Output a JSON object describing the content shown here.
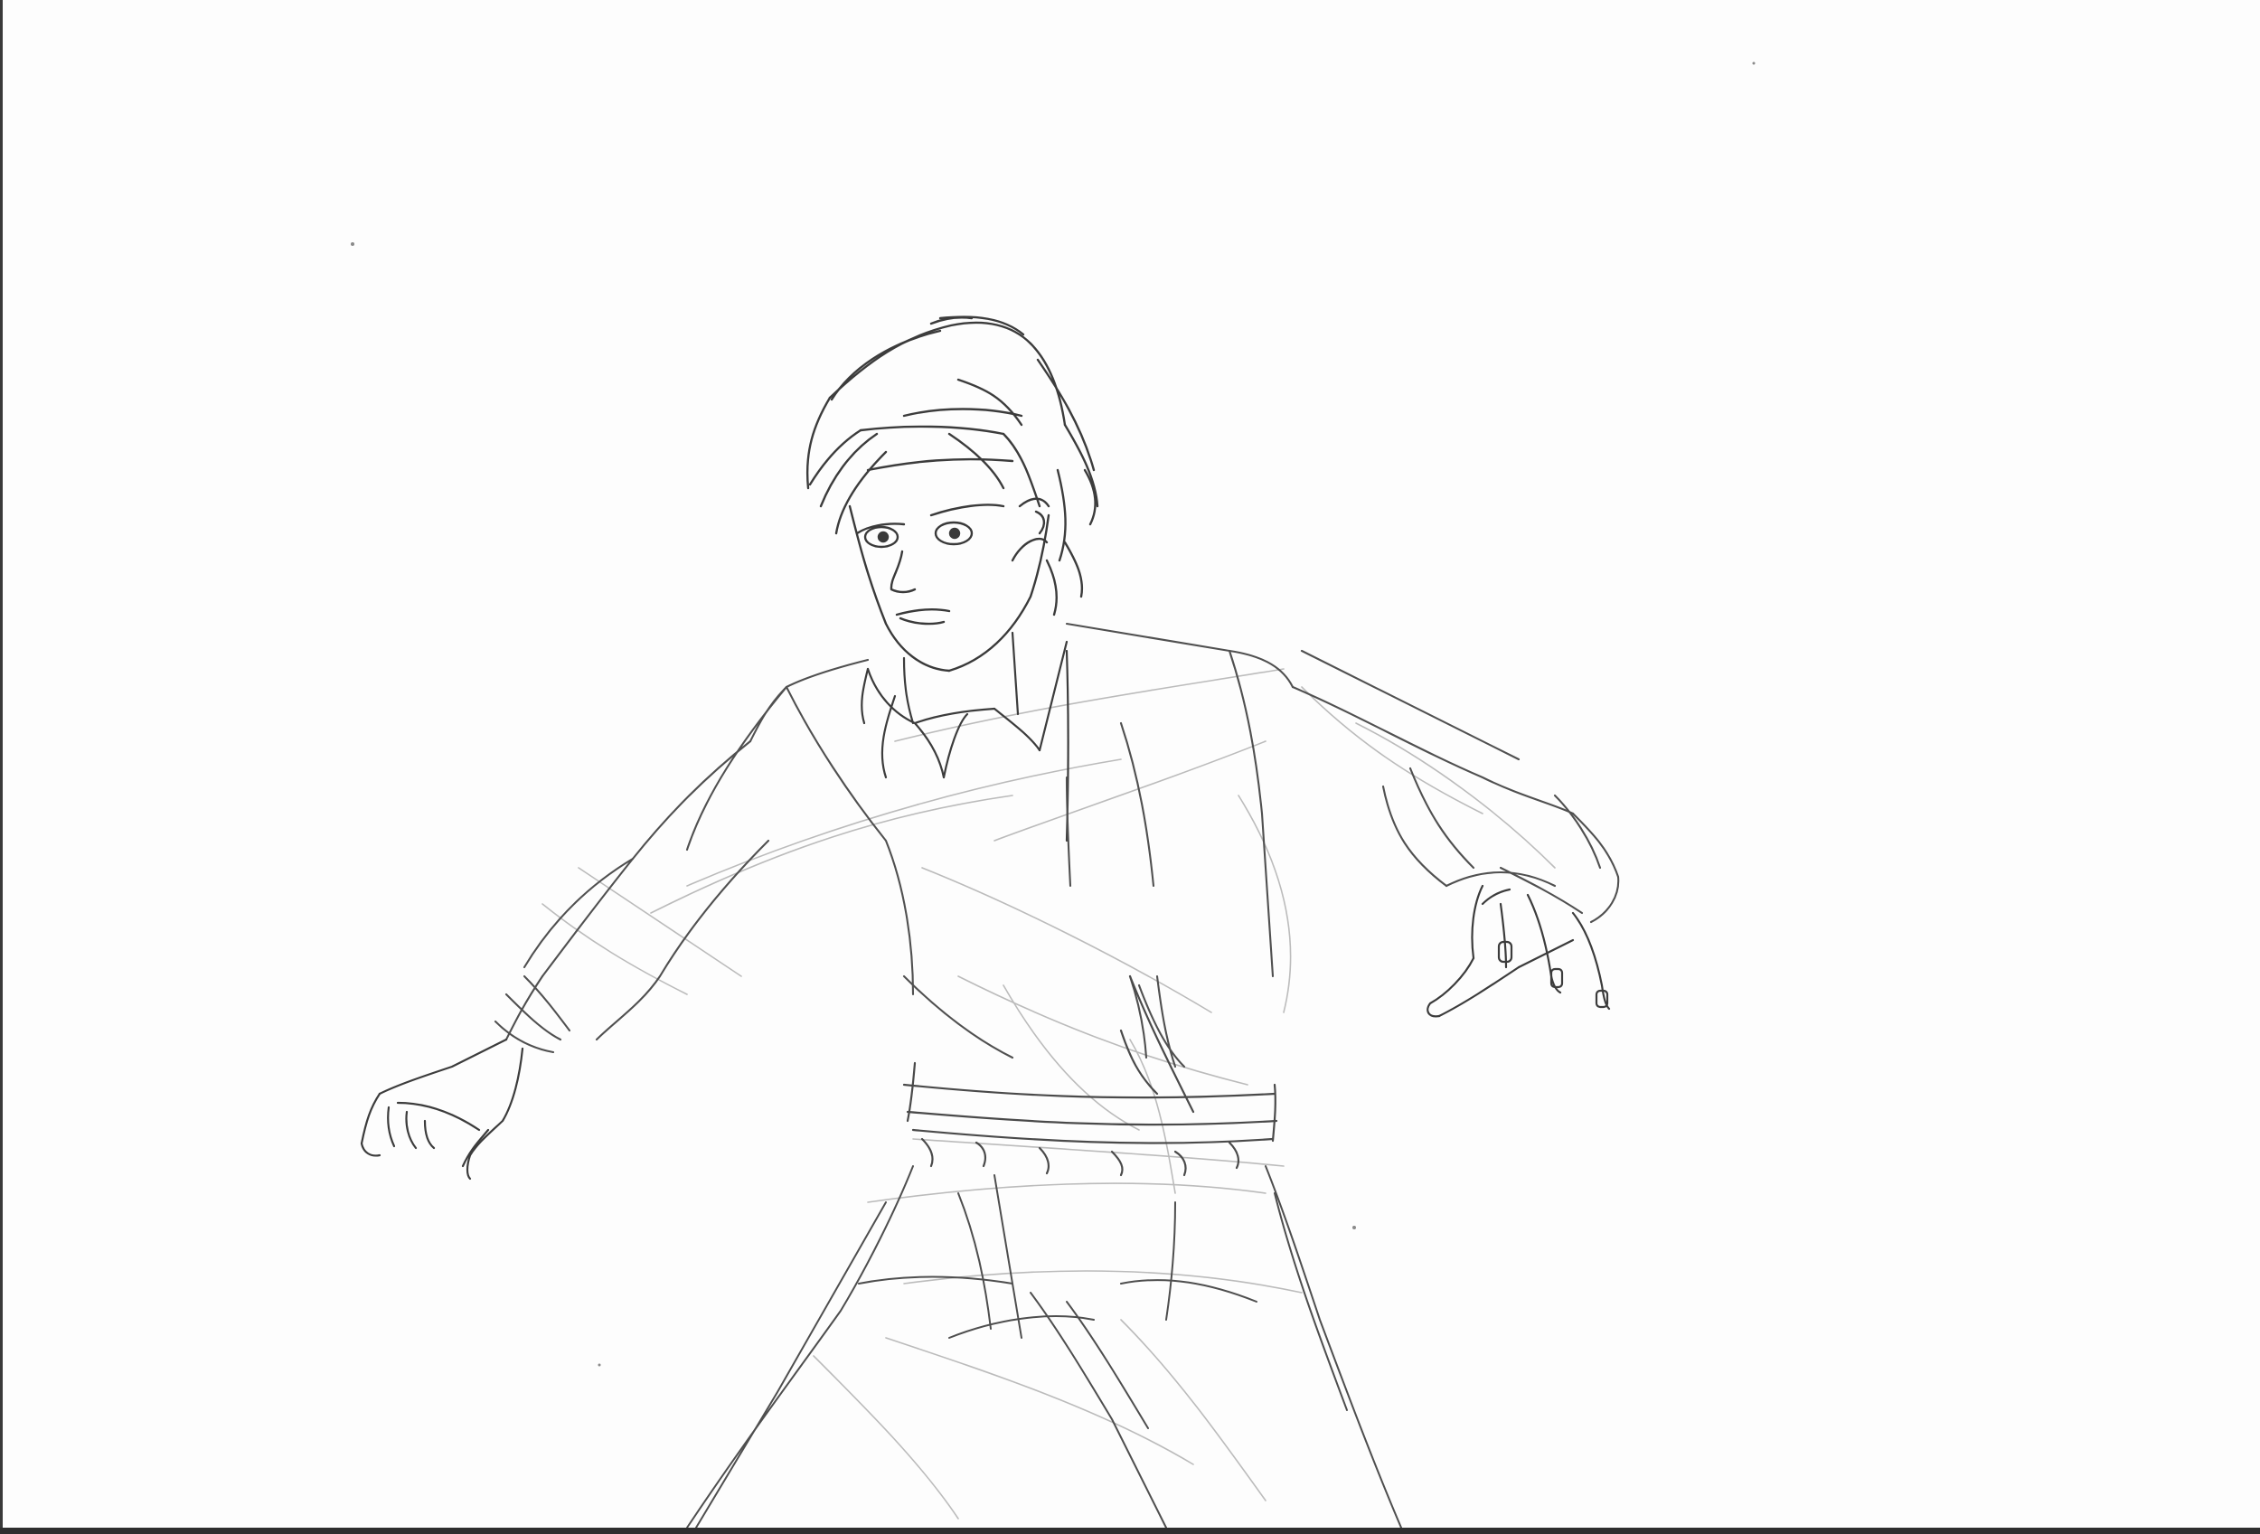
{
  "image": {
    "subject": "figure-sketch",
    "colors": {
      "paper": "#fdfdfd",
      "graphite_dark": "#3c3c3c",
      "graphite_mid": "#6e6e6e",
      "graphite_light": "#a8a8a8",
      "scan_edge": "#2e2e2e"
    }
  }
}
